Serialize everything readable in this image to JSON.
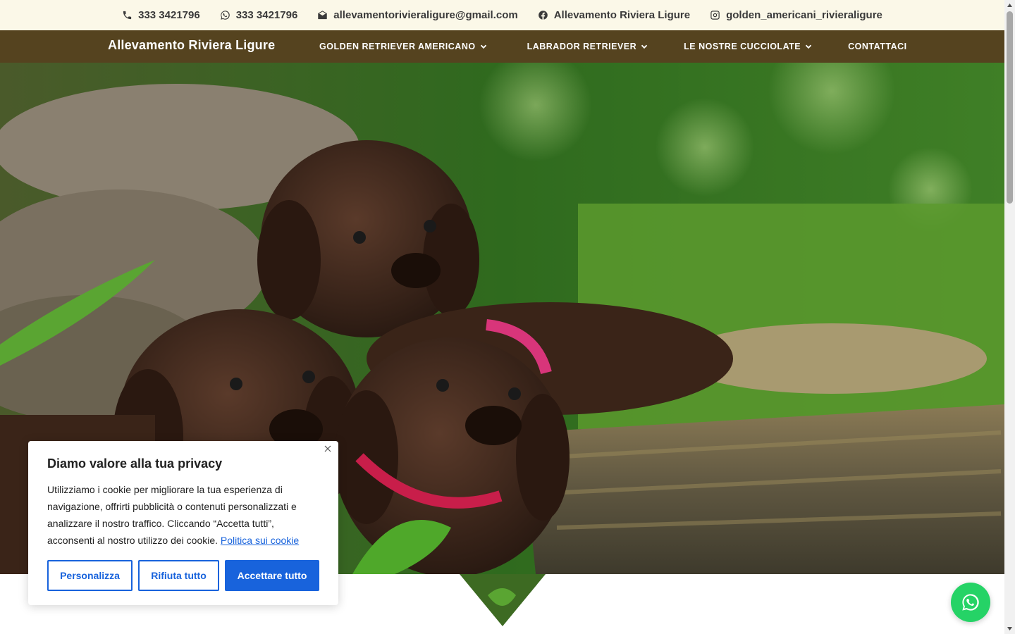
{
  "topbar": {
    "phone": "333 3421796",
    "whatsapp": "333 3421796",
    "email": "allevamentorivieraligure@gmail.com",
    "facebook": "Allevamento Riviera Ligure",
    "instagram": "golden_americani_rivieraligure"
  },
  "nav": {
    "brand": "Allevamento Riviera Ligure",
    "items": [
      {
        "label": "GOLDEN RETRIEVER AMERICANO",
        "has_dropdown": true
      },
      {
        "label": "LABRADOR RETRIEVER",
        "has_dropdown": true
      },
      {
        "label": "LE NOSTRE CUCCIOLATE",
        "has_dropdown": true
      },
      {
        "label": "CONTATTACI",
        "has_dropdown": false
      }
    ]
  },
  "cookie": {
    "title": "Diamo valore alla tua privacy",
    "text": "Utilizziamo i cookie per migliorare la tua esperienza di navigazione, offrirti pubblicità o contenuti personalizzati e analizzare il nostro traffico. Cliccando “Accetta tutti”, acconsenti al nostro utilizzo dei cookie.",
    "link": "Politica sui cookie",
    "btn_customize": "Personalizza",
    "btn_reject": "Rifiuta tutto",
    "btn_accept": "Accettare tutto"
  },
  "colors": {
    "topbar_bg": "#fbf8e8",
    "nav_bg": "#55431f",
    "cookie_accent": "#1863dc",
    "whatsapp_green": "#25d366"
  }
}
